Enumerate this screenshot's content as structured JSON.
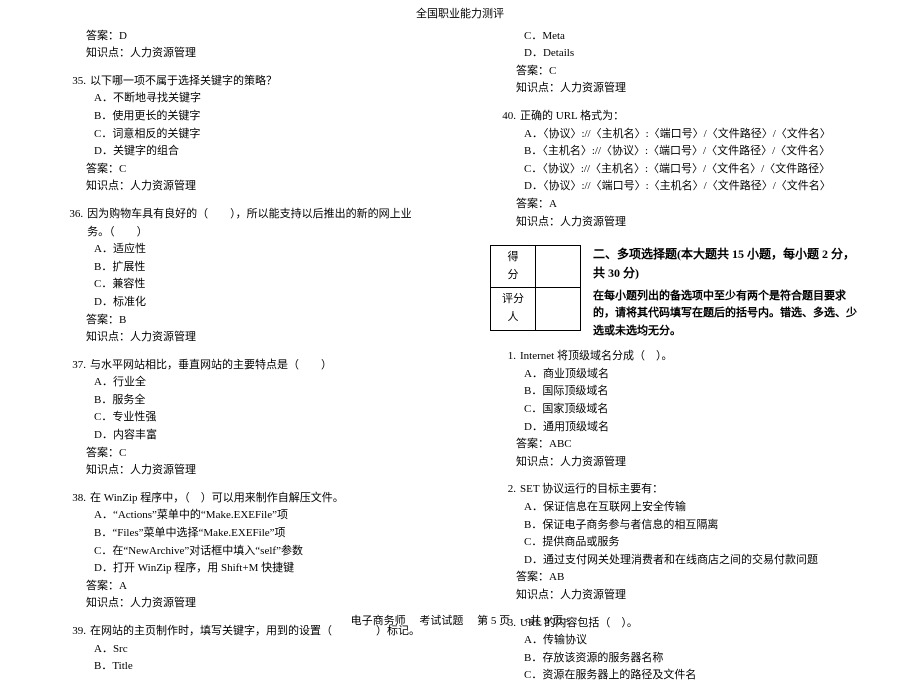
{
  "header": "全国职业能力测评",
  "footer": {
    "subject": "电子商务师",
    "paper": "考试试题",
    "page_label": "第 5 页",
    "total_label": "<共 9 页>"
  },
  "left": {
    "prev_answer": "答案：D",
    "prev_kp": "知识点：人力资源管理",
    "q35": {
      "num": "35.",
      "stem": "以下哪一项不属于选择关键字的策略？",
      "opts": [
        "A．不断地寻找关键字",
        "B．使用更长的关键字",
        "C．词意相反的关键字",
        "D．关键字的组合"
      ],
      "ans": "答案：C",
      "kp": "知识点：人力资源管理"
    },
    "q36": {
      "num": "36.",
      "stem": "因为购物车具有良好的（　　），所以能支持以后推出的新的网上业务。（　　）",
      "opts": [
        "A．适应性",
        "B．扩展性",
        "C．兼容性",
        "D．标准化"
      ],
      "ans": "答案：B",
      "kp": "知识点：人力资源管理"
    },
    "q37": {
      "num": "37.",
      "stem": "与水平网站相比，垂直网站的主要特点是（　　）",
      "opts": [
        "A．行业全",
        "B．服务全",
        "C．专业性强",
        "D．内容丰富"
      ],
      "ans": "答案：C",
      "kp": "知识点：人力资源管理"
    },
    "q38": {
      "num": "38.",
      "stem": "在 WinZip 程序中，（　）可以用来制作自解压文件。",
      "opts": [
        "A．“Actions”菜单中的“Make.EXEFile”项",
        "B．“Files”菜单中选择“Make.EXEFile”项",
        "C．在“NewArchive”对话框中填入“self”参数",
        "D．打开 WinZip 程序，用 Shift+M 快捷键"
      ],
      "ans": "答案：A",
      "kp": "知识点：人力资源管理"
    },
    "q39": {
      "num": "39.",
      "stem": "在网站的主页制作时，填写关键字，用到的设置（　　　　）标记。",
      "opts": [
        "A．Src",
        "B．Title"
      ]
    }
  },
  "right": {
    "q39_cont": {
      "opts": [
        "C．Meta",
        "D．Details"
      ],
      "ans": "答案：C",
      "kp": "知识点：人力资源管理"
    },
    "q40": {
      "num": "40.",
      "stem": "正确的 URL 格式为：",
      "opts": [
        "A．〈协议〉://〈主机名〉:〈端口号〉/〈文件路径〉/〈文件名〉",
        "B．〈主机名〉://〈协议〉:〈端口号〉/〈文件路径〉/〈文件名〉",
        "C．〈协议〉://〈主机名〉:〈端口号〉/〈文件名〉/〈文件路径〉",
        "D．〈协议〉://〈端口号〉:〈主机名〉/〈文件路径〉/〈文件名〉"
      ],
      "ans": "答案：A",
      "kp": "知识点：人力资源管理"
    },
    "section2": {
      "score_labels": [
        "得　分",
        "评分人"
      ],
      "title": "二、多项选择题(本大题共 15 小题，每小题 2 分，共 30 分)",
      "instr": "在每小题列出的备选项中至少有两个是符合题目要求的，请将其代码填写在题后的括号内。错选、多选、少选或未选均无分。"
    },
    "mq1": {
      "num": "1.",
      "stem": "Internet 将顶级域名分成（　）。",
      "opts": [
        "A．商业顶级域名",
        "B．国际顶级域名",
        "C．国家顶级域名",
        "D．通用顶级域名"
      ],
      "ans": "答案：ABC",
      "kp": "知识点：人力资源管理"
    },
    "mq2": {
      "num": "2.",
      "stem": "SET 协议运行的目标主要有：",
      "opts": [
        "A．保证信息在互联网上安全传输",
        "B．保证电子商务参与者信息的相互隔离",
        "C．提供商品或服务",
        "D．通过支付网关处理消费者和在线商店之间的交易付款问题"
      ],
      "ans": "答案：AB",
      "kp": "知识点：人力资源管理"
    },
    "mq3": {
      "num": "3.",
      "stem": "URL 的内容包括（　）。",
      "opts": [
        "A．传输协议",
        "B．存放该资源的服务器名称",
        "C．资源在服务器上的路径及文件名"
      ]
    }
  }
}
